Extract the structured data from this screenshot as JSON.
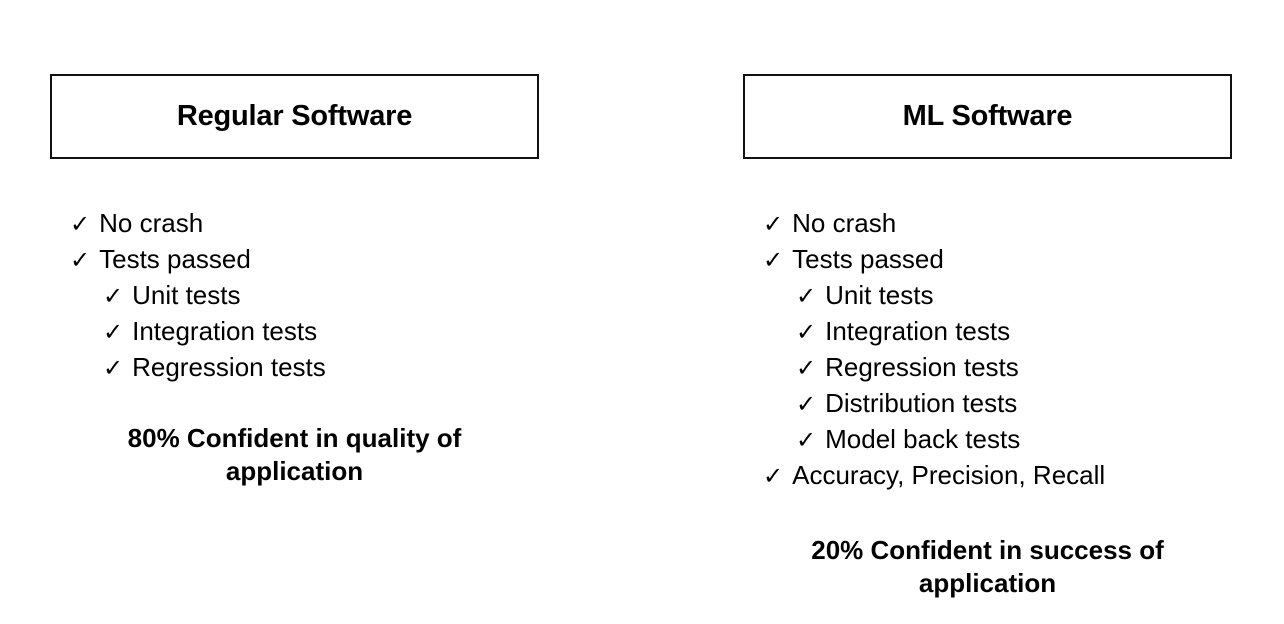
{
  "slide": {
    "background_color": "#ffffff",
    "text_color": "#000000",
    "border_color": "#111111",
    "check_icon": "✓"
  },
  "columns": [
    {
      "id": "regular-software",
      "title": "Regular Software",
      "items": [
        {
          "label": "No crash",
          "level": 0,
          "check": "✓"
        },
        {
          "label": "Tests passed",
          "level": 0,
          "check": "✓"
        },
        {
          "label": "Unit tests",
          "level": 1,
          "check": "✓"
        },
        {
          "label": "Integration tests",
          "level": 1,
          "check": "✓"
        },
        {
          "label": "Regression tests",
          "level": 1,
          "check": "✓"
        }
      ],
      "conclusion": "80% Confident in quality of application",
      "conclusion_percent": "80%"
    },
    {
      "id": "ml-software",
      "title": "ML Software",
      "items": [
        {
          "label": "No crash",
          "level": 0,
          "check": "✓"
        },
        {
          "label": "Tests passed",
          "level": 0,
          "check": "✓"
        },
        {
          "label": "Unit tests",
          "level": 1,
          "check": "✓"
        },
        {
          "label": "Integration tests",
          "level": 1,
          "check": "✓"
        },
        {
          "label": "Regression tests",
          "level": 1,
          "check": "✓"
        },
        {
          "label": "Distribution tests",
          "level": 1,
          "check": "✓"
        },
        {
          "label": "Model back tests",
          "level": 1,
          "check": "✓"
        },
        {
          "label": "Accuracy, Precision, Recall",
          "level": 0,
          "check": "✓"
        }
      ],
      "conclusion": "20% Confident in success of application",
      "conclusion_percent": "20%"
    }
  ]
}
